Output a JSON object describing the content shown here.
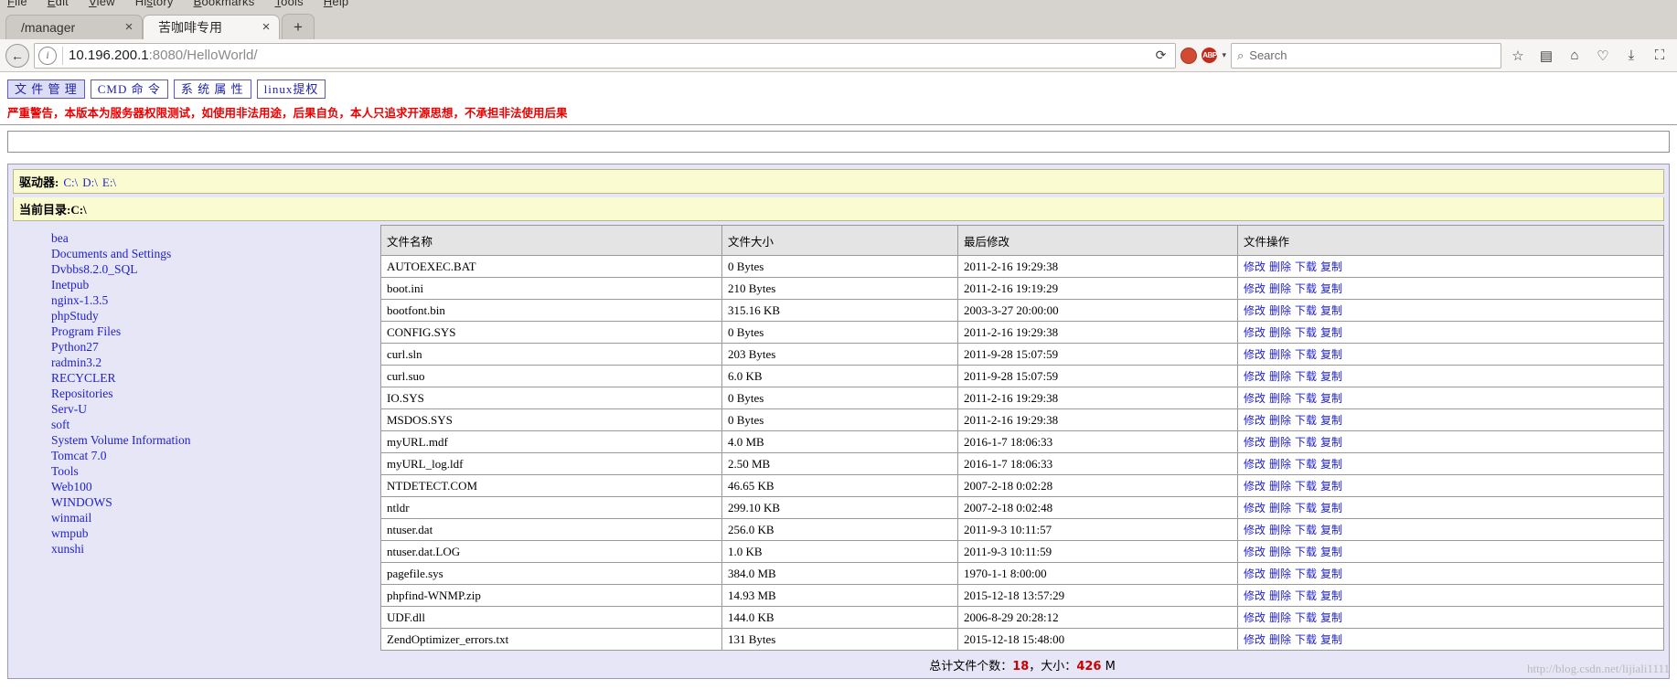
{
  "browser": {
    "menu": [
      "File",
      "Edit",
      "View",
      "History",
      "Bookmarks",
      "Tools",
      "Help"
    ],
    "tabs": [
      {
        "title": "/manager",
        "active": false
      },
      {
        "title": "苦咖啡专用",
        "active": true
      }
    ],
    "newtab_label": "+",
    "close_label": "×",
    "back_icon": "←",
    "info_icon": "i",
    "url_host": "10.196.200.1",
    "url_path": ":8080/HelloWorld/",
    "reload_icon": "⟳",
    "search_placeholder": "Search",
    "search_icon": "⌕",
    "adblock_label": "ABP",
    "caret_icon": "▾",
    "right_icons": [
      "star-icon",
      "library-icon",
      "home-icon",
      "pocket-icon",
      "download-icon",
      "menu-icon"
    ]
  },
  "shell": {
    "nav_tabs": [
      {
        "label": "文 件 管 理",
        "selected": true
      },
      {
        "label": "CMD 命 令",
        "selected": false
      },
      {
        "label": "系 统 属 性",
        "selected": false
      },
      {
        "label": "linux提权",
        "selected": false
      }
    ],
    "warning": "严重警告，本版本为服务器权限测试，如使用非法用途，后果自负，本人只追求开源思想，不承担非法使用后果",
    "drive_label": "驱动器:",
    "drives": [
      "C:\\",
      "D:\\",
      "E:\\"
    ],
    "current_dir": "当前目录:C:\\",
    "folders": [
      "bea",
      "Documents and Settings",
      "Dvbbs8.2.0_SQL",
      "Inetpub",
      "nginx-1.3.5",
      "phpStudy",
      "Program Files",
      "Python27",
      "radmin3.2",
      "RECYCLER",
      "Repositories",
      "Serv-U",
      "soft",
      "System Volume Information",
      "Tomcat 7.0",
      "Tools",
      "Web100",
      "WINDOWS",
      "winmail",
      "wmpub",
      "xunshi"
    ],
    "table": {
      "headers": [
        "文件名称",
        "文件大小",
        "最后修改",
        "文件操作"
      ],
      "ops": [
        "修改",
        "删除",
        "下载",
        "复制"
      ],
      "rows": [
        {
          "name": "AUTOEXEC.BAT",
          "size": "0 Bytes",
          "modified": "2011-2-16 19:29:38"
        },
        {
          "name": "boot.ini",
          "size": "210 Bytes",
          "modified": "2011-2-16 19:19:29"
        },
        {
          "name": "bootfont.bin",
          "size": "315.16 KB",
          "modified": "2003-3-27 20:00:00"
        },
        {
          "name": "CONFIG.SYS",
          "size": "0 Bytes",
          "modified": "2011-2-16 19:29:38"
        },
        {
          "name": "curl.sln",
          "size": "203 Bytes",
          "modified": "2011-9-28 15:07:59"
        },
        {
          "name": "curl.suo",
          "size": "6.0 KB",
          "modified": "2011-9-28 15:07:59"
        },
        {
          "name": "IO.SYS",
          "size": "0 Bytes",
          "modified": "2011-2-16 19:29:38"
        },
        {
          "name": "MSDOS.SYS",
          "size": "0 Bytes",
          "modified": "2011-2-16 19:29:38"
        },
        {
          "name": "myURL.mdf",
          "size": "4.0 MB",
          "modified": "2016-1-7 18:06:33"
        },
        {
          "name": "myURL_log.ldf",
          "size": "2.50 MB",
          "modified": "2016-1-7 18:06:33"
        },
        {
          "name": "NTDETECT.COM",
          "size": "46.65 KB",
          "modified": "2007-2-18 0:02:28"
        },
        {
          "name": "ntldr",
          "size": "299.10 KB",
          "modified": "2007-2-18 0:02:48"
        },
        {
          "name": "ntuser.dat",
          "size": "256.0 KB",
          "modified": "2011-9-3 10:11:57"
        },
        {
          "name": "ntuser.dat.LOG",
          "size": "1.0 KB",
          "modified": "2011-9-3 10:11:59"
        },
        {
          "name": "pagefile.sys",
          "size": "384.0 MB",
          "modified": "1970-1-1 8:00:00"
        },
        {
          "name": "phpfind-WNMP.zip",
          "size": "14.93 MB",
          "modified": "2015-12-18 13:57:29"
        },
        {
          "name": "UDF.dll",
          "size": "144.0 KB",
          "modified": "2006-8-29 20:28:12"
        },
        {
          "name": "ZendOptimizer_errors.txt",
          "size": "131 Bytes",
          "modified": "2015-12-18 15:48:00"
        }
      ],
      "total_prefix": "总计文件个数：",
      "total_count": "18",
      "total_middle": "，大小：",
      "total_size": "426",
      "total_suffix": " M"
    },
    "watermark": "http://blog.csdn.net/lijiali1111"
  }
}
